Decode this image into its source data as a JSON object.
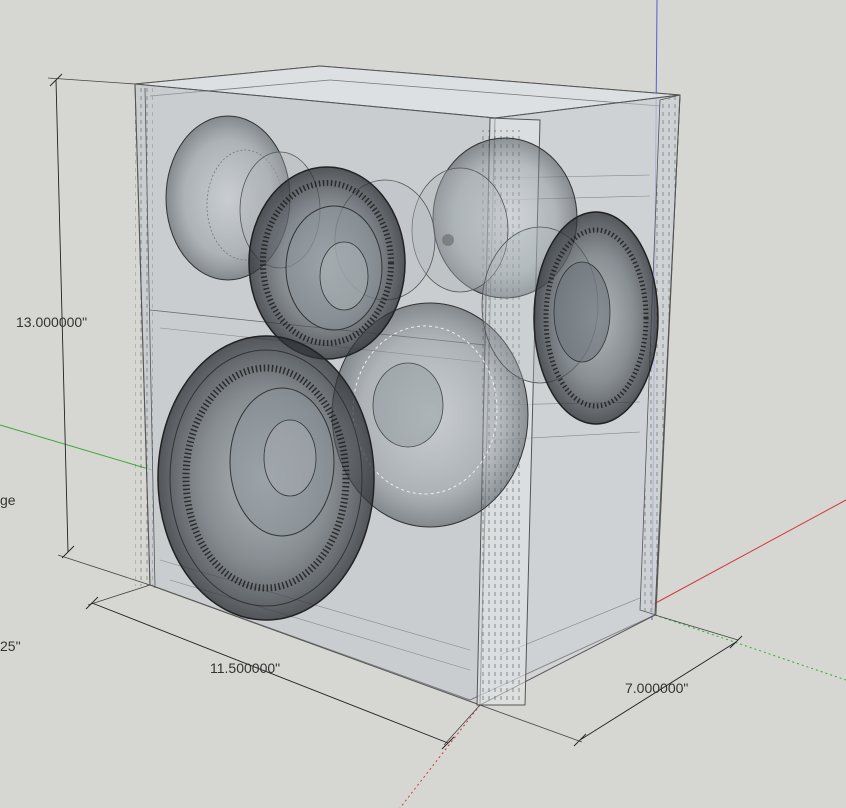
{
  "viewport": {
    "background": "#d6d6d2",
    "axis_colors": {
      "red": "#d33a3a",
      "green": "#3aa83a",
      "blue": "#3a3ad3"
    }
  },
  "model": {
    "name": "speaker-enclosure",
    "drivers": [
      "woofer-large",
      "woofer-upper-left",
      "midrange-rear",
      "midrange-center",
      "tweeter-right",
      "midrange-right-rear"
    ]
  },
  "dimensions": {
    "height": "13.000000\"",
    "width": "11.500000\"",
    "depth": "7.000000\"",
    "partial_label_1": "ge",
    "partial_label_2": "25\""
  }
}
